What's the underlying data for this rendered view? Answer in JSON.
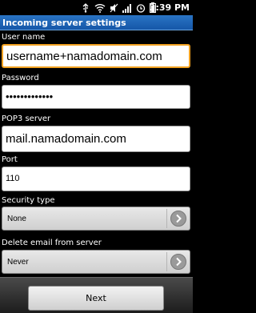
{
  "status_bar": {
    "time": "3:39 PM",
    "icons": [
      "usb-icon",
      "wifi-icon",
      "mute-icon",
      "signal-icon",
      "alarm-icon",
      "battery-icon"
    ]
  },
  "title": "Incoming server settings",
  "form": {
    "username": {
      "label": "User name",
      "value": "username+namadomain.com"
    },
    "password": {
      "label": "Password",
      "value": "•••••••••••••"
    },
    "server": {
      "label": "POP3 server",
      "value": "mail.namadomain.com"
    },
    "port": {
      "label": "Port",
      "value": "110"
    },
    "security": {
      "label": "Security type",
      "value": "None"
    },
    "delete_email": {
      "label": "Delete email from server",
      "value": "Never"
    }
  },
  "buttons": {
    "next": "Next"
  },
  "colors": {
    "title_bar": "#1e66b8",
    "focus_border": "#f0a020",
    "background": "#000000"
  }
}
